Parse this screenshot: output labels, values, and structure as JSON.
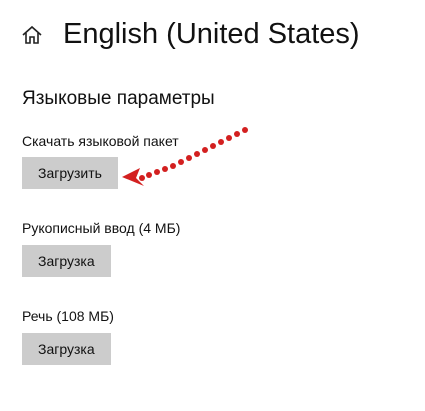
{
  "header": {
    "home_icon": "home-icon",
    "title": "English (United States)"
  },
  "section": {
    "title": "Языковые параметры"
  },
  "language_pack": {
    "label": "Скачать языковой пакет",
    "button_label": "Загрузить"
  },
  "handwriting": {
    "label": "Рукописный ввод (4 МБ)",
    "button_label": "Загрузка"
  },
  "speech": {
    "label": "Речь (108 МБ)",
    "button_label": "Загрузка"
  },
  "annotation": {
    "icon": "dotted-arrow-icon",
    "color": "#d32020"
  },
  "colors": {
    "button_bg": "#cccccc",
    "text": "#111111",
    "background": "#ffffff"
  }
}
